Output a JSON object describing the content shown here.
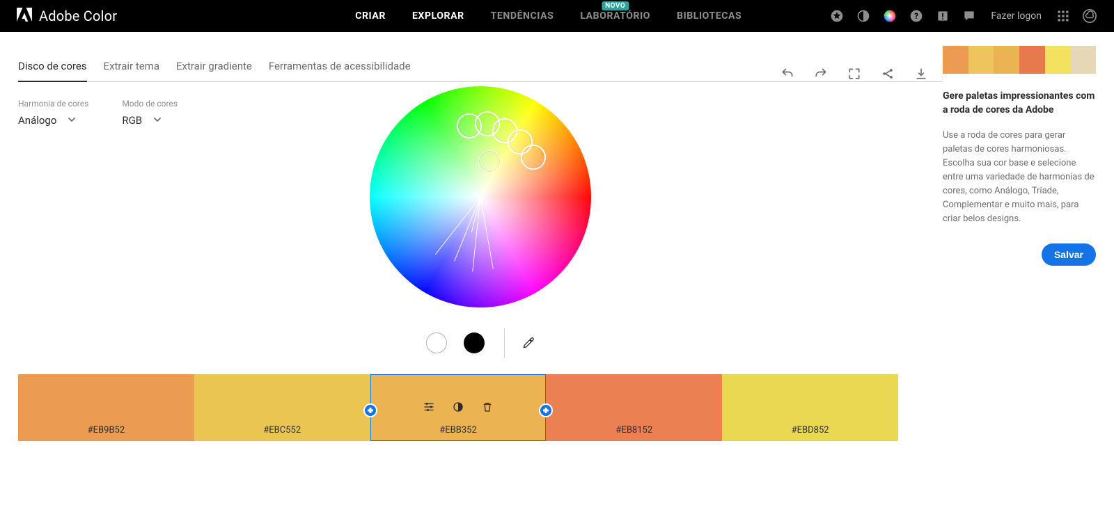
{
  "brand": "Adobe Color",
  "nav": {
    "items": [
      {
        "label": "Criar",
        "active": true
      },
      {
        "label": "Explorar",
        "active": true
      },
      {
        "label": "Tendências",
        "active": false
      },
      {
        "label": "Laboratório",
        "active": false,
        "badge": "NOVO"
      },
      {
        "label": "Bibliotecas",
        "active": false
      }
    ],
    "login": "Fazer logon"
  },
  "tabs": [
    {
      "label": "Disco de cores",
      "active": true
    },
    {
      "label": "Extrair tema",
      "active": false
    },
    {
      "label": "Extrair gradiente",
      "active": false
    },
    {
      "label": "Ferramentas de acessibilidade",
      "active": false
    }
  ],
  "harmony": {
    "label": "Harmonia de cores",
    "value": "Análogo"
  },
  "colormode": {
    "label": "Modo de cores",
    "value": "RGB"
  },
  "swatches": [
    {
      "hex": "#EB9B52"
    },
    {
      "hex": "#EBC552"
    },
    {
      "hex": "#EBB352",
      "selected": true
    },
    {
      "hex": "#EB8152"
    },
    {
      "hex": "#EBD852"
    }
  ],
  "preview": [
    "#EB9B52",
    "#EBC552",
    "#EBB352",
    "#EB8152",
    "#EBD852"
  ],
  "previewAlt": [
    "#EB9B52",
    "#F0C45C",
    "#EBB352",
    "#E67A4C",
    "#F3E160",
    "#E6D7B6"
  ],
  "sidebar": {
    "title": "Gere paletas impressionantes com a roda de cores da Adobe",
    "body": "Use a roda de cores para gerar paletas de cores harmoniosas. Escolha sua cor base e selecione entre uma variedade de harmonias de cores, como Análogo, Tríade, Complementar e muito mais, para criar belos designs.",
    "save": "Salvar"
  }
}
